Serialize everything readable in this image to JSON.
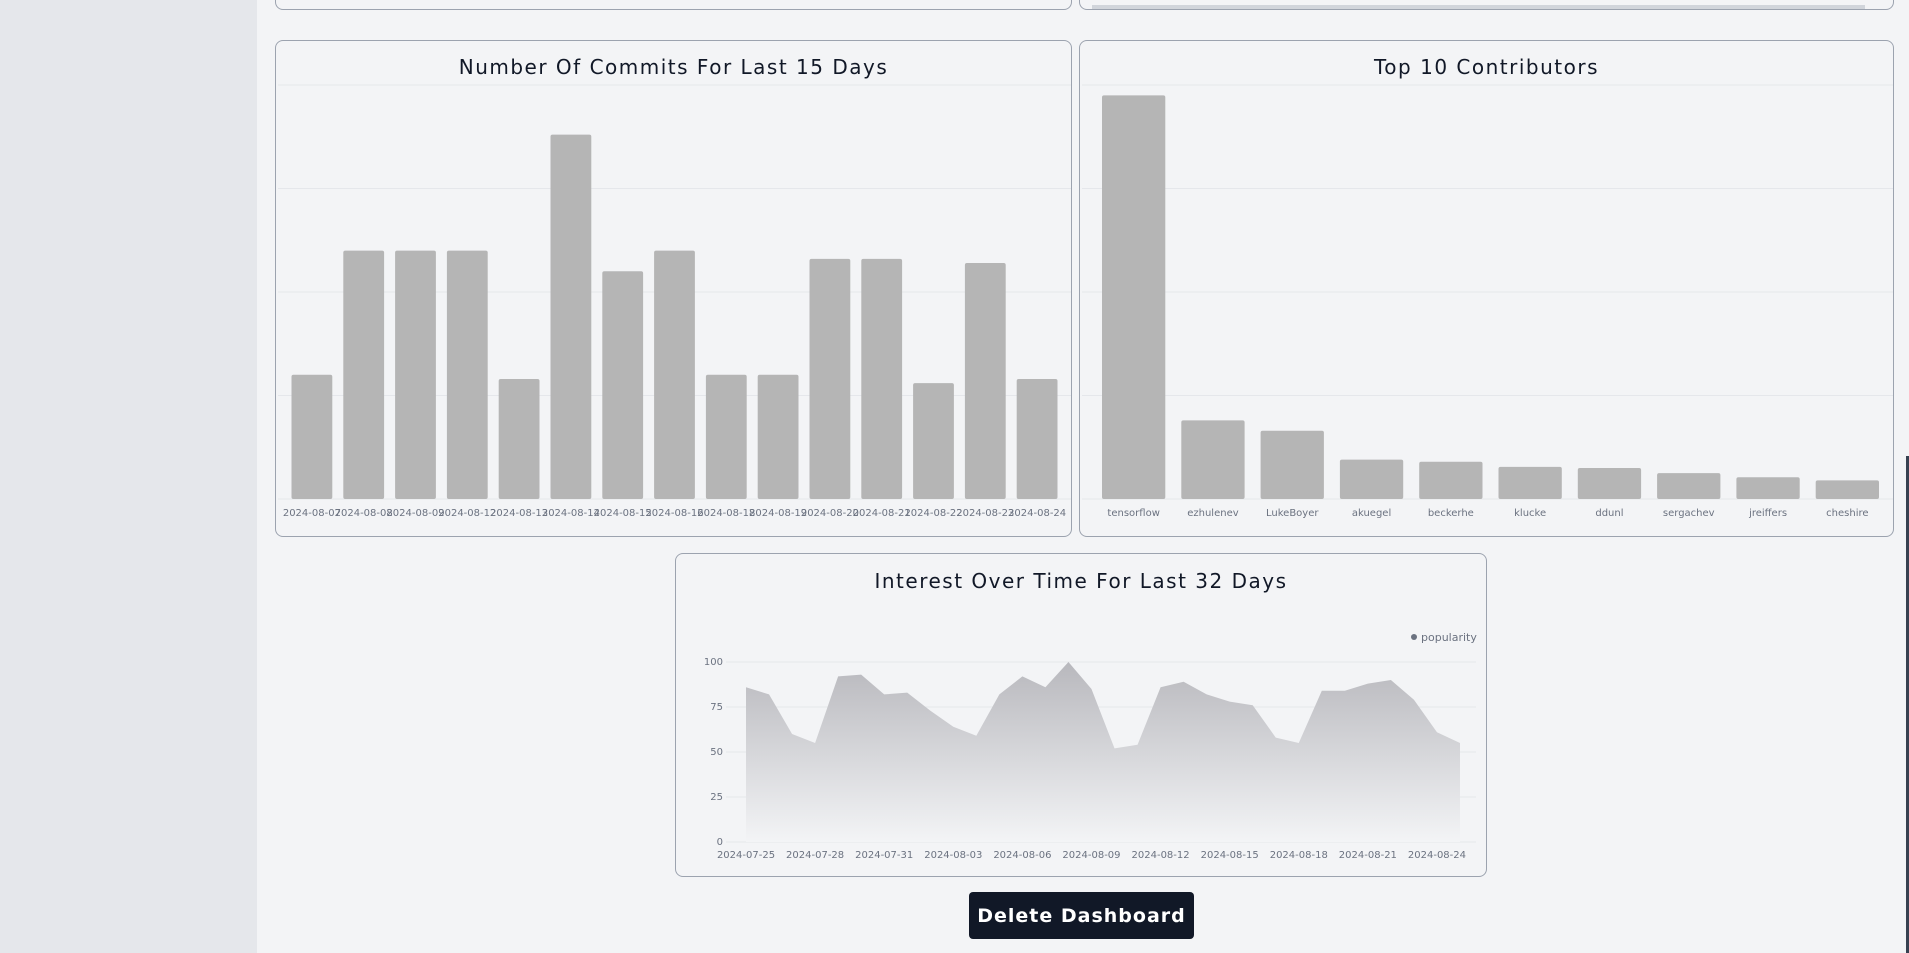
{
  "colors": {
    "bar": "#b5b5b5",
    "area_top": "#b8b8bd",
    "area_bottom": "#f3f4f6",
    "button_bg": "#111827",
    "legend_dot": "#6b7280"
  },
  "commits_chart": {
    "title": "Number Of Commits For Last 15 Days",
    "chart_data": {
      "type": "bar",
      "categories": [
        "2024-08-07",
        "2024-08-08",
        "2024-08-09",
        "2024-08-12",
        "2024-08-13",
        "2024-08-14",
        "2024-08-15",
        "2024-08-16",
        "2024-08-18",
        "2024-08-19",
        "2024-08-20",
        "2024-08-21",
        "2024-08-22",
        "2024-08-23",
        "2024-08-24"
      ],
      "values": [
        30,
        60,
        60,
        60,
        29,
        88,
        55,
        60,
        30,
        30,
        58,
        58,
        28,
        57,
        29
      ],
      "ylim": [
        0,
        100
      ],
      "grid": true
    }
  },
  "contributors_chart": {
    "title": "Top 10 Contributors",
    "chart_data": {
      "type": "bar",
      "categories": [
        "tensorflow",
        "ezhulenev",
        "LukeBoyer",
        "akuegel",
        "beckerhe",
        "klucke",
        "ddunl",
        "sergachev",
        "jreiffers",
        "cheshire"
      ],
      "values": [
        390,
        76,
        66,
        38,
        36,
        31,
        30,
        25,
        21,
        18
      ],
      "ylim": [
        0,
        400
      ],
      "grid": true
    }
  },
  "interest_chart": {
    "title": "Interest Over Time For Last 32 Days",
    "legend": "popularity",
    "chart_data": {
      "type": "area",
      "x": [
        "2024-07-25",
        "2024-07-26",
        "2024-07-27",
        "2024-07-28",
        "2024-07-29",
        "2024-07-30",
        "2024-07-31",
        "2024-08-01",
        "2024-08-02",
        "2024-08-03",
        "2024-08-04",
        "2024-08-05",
        "2024-08-06",
        "2024-08-07",
        "2024-08-08",
        "2024-08-09",
        "2024-08-10",
        "2024-08-11",
        "2024-08-12",
        "2024-08-13",
        "2024-08-14",
        "2024-08-15",
        "2024-08-16",
        "2024-08-17",
        "2024-08-18",
        "2024-08-19",
        "2024-08-20",
        "2024-08-21",
        "2024-08-22",
        "2024-08-23",
        "2024-08-24",
        "2024-08-25"
      ],
      "series": [
        {
          "name": "popularity",
          "values": [
            86,
            82,
            60,
            55,
            92,
            93,
            82,
            83,
            73,
            64,
            59,
            82,
            92,
            86,
            100,
            85,
            52,
            54,
            86,
            89,
            82,
            78,
            76,
            58,
            55,
            84,
            84,
            88,
            90,
            79,
            61,
            55
          ]
        }
      ],
      "x_ticks": [
        "2024-07-25",
        "2024-07-28",
        "2024-07-31",
        "2024-08-03",
        "2024-08-06",
        "2024-08-09",
        "2024-08-12",
        "2024-08-15",
        "2024-08-18",
        "2024-08-21",
        "2024-08-24"
      ],
      "y_ticks": [
        "0",
        "25",
        "50",
        "75",
        "100"
      ],
      "ylim": [
        0,
        100
      ],
      "legend_position": "top-right"
    }
  },
  "actions": {
    "delete_label": "Delete Dashboard"
  }
}
